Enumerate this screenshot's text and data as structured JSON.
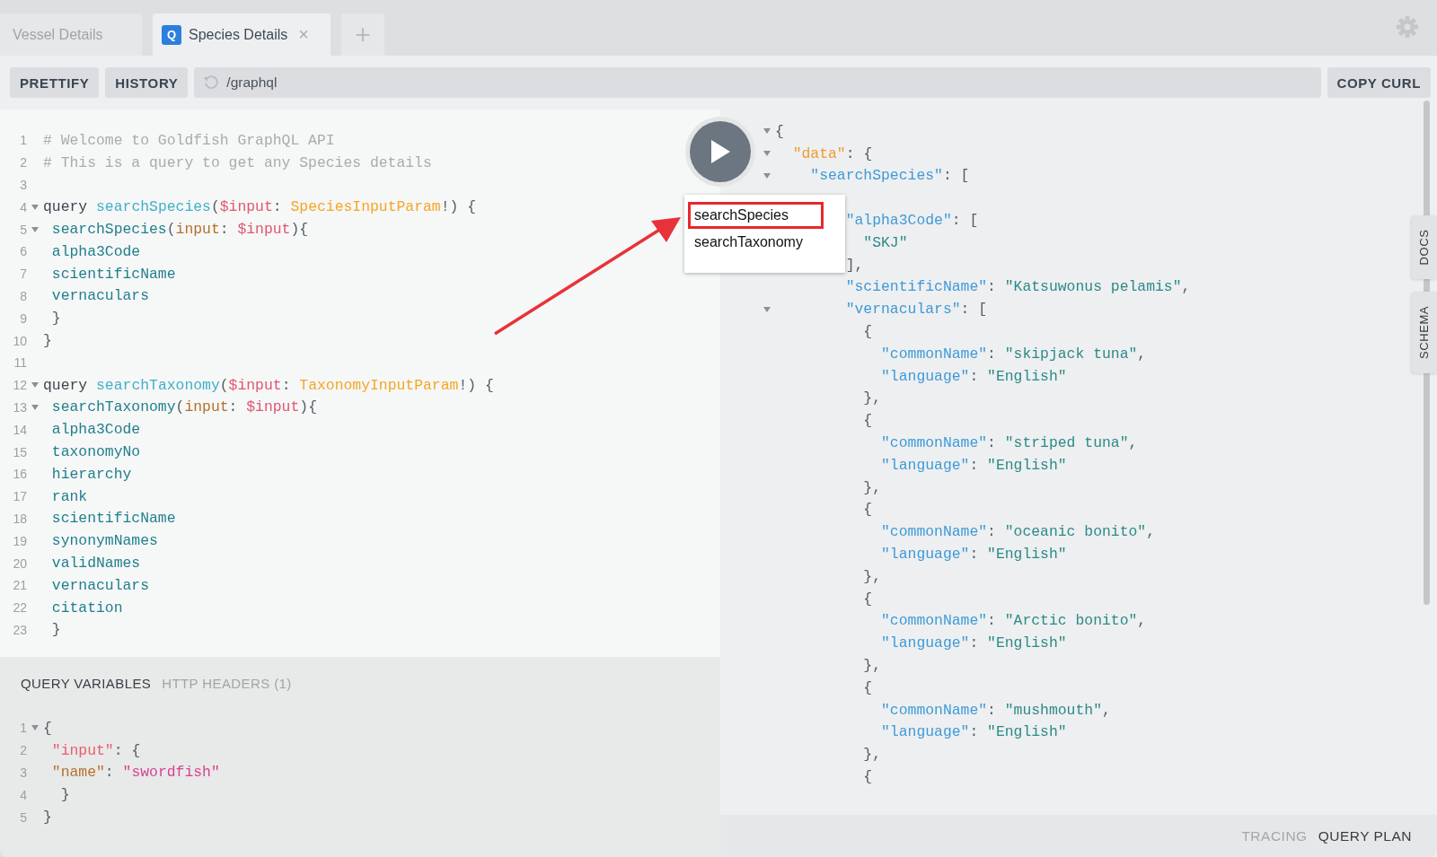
{
  "tabs": [
    {
      "label": "Vessel Details",
      "selected": false
    },
    {
      "label": "Species Details",
      "selected": true,
      "badge": "Q",
      "close": "×"
    }
  ],
  "add_tab": "+",
  "toolbar": {
    "buttons": [
      "PRETTIFY",
      "HISTORY"
    ],
    "url": "/graphql",
    "copy_button": "COPY CURL"
  },
  "editor": {
    "lines": [
      {
        "number": "1",
        "tokens": [
          {
            "kind": "comment",
            "text": "# Welcome to Goldfish GraphQL API"
          }
        ]
      },
      {
        "number": "2",
        "tokens": [
          {
            "kind": "comment",
            "text": "# This is a query to get any Species details"
          }
        ]
      },
      {
        "number": "3"
      },
      {
        "number": "4",
        "fold_marker": true,
        "tokens": [
          {
            "kind": "keyword",
            "text": "query "
          },
          {
            "kind": "def",
            "text": "searchSpecies"
          },
          {
            "kind": "punct",
            "text": "("
          },
          {
            "kind": "variable",
            "text": "$input"
          },
          {
            "kind": "punct",
            "text": ": "
          },
          {
            "kind": "type",
            "text": "SpeciesInputParam"
          },
          {
            "kind": "punct",
            "text": "!) {"
          }
        ]
      },
      {
        "number": "5",
        "fold_marker": true,
        "tokens": [
          {
            "kind": "field",
            "text": " searchSpecies"
          },
          {
            "kind": "punct",
            "text": "("
          },
          {
            "kind": "attribute",
            "text": "input"
          },
          {
            "kind": "punct",
            "text": ": "
          },
          {
            "kind": "variable",
            "text": "$input"
          },
          {
            "kind": "punct",
            "text": "){"
          }
        ]
      },
      {
        "number": "6",
        "tokens": [
          {
            "kind": "field",
            "text": " alpha3Code"
          }
        ]
      },
      {
        "number": "7",
        "tokens": [
          {
            "kind": "field",
            "text": " scientificName"
          }
        ]
      },
      {
        "number": "8",
        "tokens": [
          {
            "kind": "field",
            "text": " vernaculars"
          }
        ]
      },
      {
        "number": "9",
        "tokens": [
          {
            "kind": "punct",
            "text": " }"
          }
        ]
      },
      {
        "number": "10",
        "tokens": [
          {
            "kind": "punct",
            "text": "}"
          }
        ]
      },
      {
        "number": "11"
      },
      {
        "number": "12",
        "fold_marker": true,
        "tokens": [
          {
            "kind": "keyword",
            "text": "query "
          },
          {
            "kind": "def",
            "text": "searchTaxonomy"
          },
          {
            "kind": "punct",
            "text": "("
          },
          {
            "kind": "variable",
            "text": "$input"
          },
          {
            "kind": "punct",
            "text": ": "
          },
          {
            "kind": "type",
            "text": "TaxonomyInputParam"
          },
          {
            "kind": "punct",
            "text": "!) {"
          }
        ]
      },
      {
        "number": "13",
        "fold_marker": true,
        "tokens": [
          {
            "kind": "field",
            "text": " searchTaxonomy"
          },
          {
            "kind": "punct",
            "text": "("
          },
          {
            "kind": "attribute",
            "text": "input"
          },
          {
            "kind": "punct",
            "text": ": "
          },
          {
            "kind": "variable",
            "text": "$input"
          },
          {
            "kind": "punct",
            "text": "){"
          }
        ]
      },
      {
        "number": "14",
        "tokens": [
          {
            "kind": "field",
            "text": " alpha3Code"
          }
        ]
      },
      {
        "number": "15",
        "tokens": [
          {
            "kind": "field",
            "text": " taxonomyNo"
          }
        ]
      },
      {
        "number": "16",
        "tokens": [
          {
            "kind": "field",
            "text": " hierarchy"
          }
        ]
      },
      {
        "number": "17",
        "tokens": [
          {
            "kind": "field",
            "text": " rank"
          }
        ]
      },
      {
        "number": "18",
        "tokens": [
          {
            "kind": "field",
            "text": " scientificName"
          }
        ]
      },
      {
        "number": "19",
        "tokens": [
          {
            "kind": "field",
            "text": " synonymNames"
          }
        ]
      },
      {
        "number": "20",
        "tokens": [
          {
            "kind": "field",
            "text": " validNames"
          }
        ]
      },
      {
        "number": "21",
        "tokens": [
          {
            "kind": "field",
            "text": " vernaculars"
          }
        ]
      },
      {
        "number": "22",
        "tokens": [
          {
            "kind": "field",
            "text": " citation"
          }
        ]
      },
      {
        "number": "23",
        "tokens": [
          {
            "kind": "punct",
            "text": " }"
          }
        ]
      }
    ]
  },
  "variables": {
    "tabs": [
      {
        "label": "QUERY VARIABLES",
        "selected": true
      },
      {
        "label": "HTTP HEADERS (1)",
        "selected": false
      }
    ],
    "lines": [
      {
        "number": "1",
        "fold_marker": true,
        "tokens": [
          {
            "kind": "punct",
            "text": "{"
          }
        ]
      },
      {
        "number": "2",
        "tokens": [
          {
            "kind": "key",
            "text": " \"input\""
          },
          {
            "kind": "punct",
            "text": ": {"
          }
        ]
      },
      {
        "number": "3",
        "tokens": [
          {
            "kind": "attribute",
            "text": " \"name\""
          },
          {
            "kind": "punct",
            "text": ": "
          },
          {
            "kind": "string",
            "text": "\"swordfish\""
          }
        ]
      },
      {
        "number": "4",
        "tokens": [
          {
            "kind": "punct",
            "text": "  }"
          }
        ]
      },
      {
        "number": "5",
        "tokens": [
          {
            "kind": "punct",
            "text": "}"
          }
        ]
      }
    ]
  },
  "run_menu": {
    "operations": [
      {
        "name": "searchSpecies",
        "highlighted": true
      },
      {
        "name": "searchTaxonomy",
        "highlighted": false
      }
    ]
  },
  "annotation": {
    "kind": "arrow"
  },
  "result": {
    "lines": [
      {
        "fold_marker": true,
        "tokens": [
          {
            "kind": "punct",
            "text": "{"
          }
        ]
      },
      {
        "fold_marker": true,
        "tokens": [
          {
            "kind": "accent",
            "text": "  \"data\""
          },
          {
            "kind": "punct",
            "text": ": {"
          }
        ]
      },
      {
        "fold_marker": true,
        "tokens": [
          {
            "kind": "key",
            "text": "    \"searchSpecies\""
          },
          {
            "kind": "punct",
            "text": ": ["
          }
        ]
      },
      {
        "blank_line_before": true,
        "tokens": [
          {
            "kind": "key",
            "text": "        \"alpha3Code\""
          },
          {
            "kind": "punct",
            "text": ": ["
          }
        ]
      },
      {
        "tokens": [
          {
            "kind": "string",
            "text": "          \"SKJ\""
          }
        ]
      },
      {
        "tokens": [
          {
            "kind": "punct",
            "text": "        ],"
          }
        ]
      },
      {
        "tokens": [
          {
            "kind": "key",
            "text": "        \"scientificName\""
          },
          {
            "kind": "punct",
            "text": ": "
          },
          {
            "kind": "string",
            "text": "\"Katsuwonus pelamis\""
          },
          {
            "kind": "punct",
            "text": ","
          }
        ]
      },
      {
        "fold_marker": true,
        "tokens": [
          {
            "kind": "key",
            "text": "        \"vernaculars\""
          },
          {
            "kind": "punct",
            "text": ": ["
          }
        ]
      },
      {
        "tokens": [
          {
            "kind": "punct",
            "text": "          {"
          }
        ]
      },
      {
        "tokens": [
          {
            "kind": "key",
            "text": "            \"commonName\""
          },
          {
            "kind": "punct",
            "text": ": "
          },
          {
            "kind": "string",
            "text": "\"skipjack tuna\""
          },
          {
            "kind": "punct",
            "text": ","
          }
        ]
      },
      {
        "tokens": [
          {
            "kind": "key",
            "text": "            \"language\""
          },
          {
            "kind": "punct",
            "text": ": "
          },
          {
            "kind": "string",
            "text": "\"English\""
          }
        ]
      },
      {
        "tokens": [
          {
            "kind": "punct",
            "text": "          },"
          }
        ]
      },
      {
        "tokens": [
          {
            "kind": "punct",
            "text": "          {"
          }
        ]
      },
      {
        "tokens": [
          {
            "kind": "key",
            "text": "            \"commonName\""
          },
          {
            "kind": "punct",
            "text": ": "
          },
          {
            "kind": "string",
            "text": "\"striped tuna\""
          },
          {
            "kind": "punct",
            "text": ","
          }
        ]
      },
      {
        "tokens": [
          {
            "kind": "key",
            "text": "            \"language\""
          },
          {
            "kind": "punct",
            "text": ": "
          },
          {
            "kind": "string",
            "text": "\"English\""
          }
        ]
      },
      {
        "tokens": [
          {
            "kind": "punct",
            "text": "          },"
          }
        ]
      },
      {
        "tokens": [
          {
            "kind": "punct",
            "text": "          {"
          }
        ]
      },
      {
        "tokens": [
          {
            "kind": "key",
            "text": "            \"commonName\""
          },
          {
            "kind": "punct",
            "text": ": "
          },
          {
            "kind": "string",
            "text": "\"oceanic bonito\""
          },
          {
            "kind": "punct",
            "text": ","
          }
        ]
      },
      {
        "tokens": [
          {
            "kind": "key",
            "text": "            \"language\""
          },
          {
            "kind": "punct",
            "text": ": "
          },
          {
            "kind": "string",
            "text": "\"English\""
          }
        ]
      },
      {
        "tokens": [
          {
            "kind": "punct",
            "text": "          },"
          }
        ]
      },
      {
        "tokens": [
          {
            "kind": "punct",
            "text": "          {"
          }
        ]
      },
      {
        "tokens": [
          {
            "kind": "key",
            "text": "            \"commonName\""
          },
          {
            "kind": "punct",
            "text": ": "
          },
          {
            "kind": "string",
            "text": "\"Arctic bonito\""
          },
          {
            "kind": "punct",
            "text": ","
          }
        ]
      },
      {
        "tokens": [
          {
            "kind": "key",
            "text": "            \"language\""
          },
          {
            "kind": "punct",
            "text": ": "
          },
          {
            "kind": "string",
            "text": "\"English\""
          }
        ]
      },
      {
        "tokens": [
          {
            "kind": "punct",
            "text": "          },"
          }
        ]
      },
      {
        "tokens": [
          {
            "kind": "punct",
            "text": "          {"
          }
        ]
      },
      {
        "tokens": [
          {
            "kind": "key",
            "text": "            \"commonName\""
          },
          {
            "kind": "punct",
            "text": ": "
          },
          {
            "kind": "string",
            "text": "\"mushmouth\""
          },
          {
            "kind": "punct",
            "text": ","
          }
        ]
      },
      {
        "tokens": [
          {
            "kind": "key",
            "text": "            \"language\""
          },
          {
            "kind": "punct",
            "text": ": "
          },
          {
            "kind": "string",
            "text": "\"English\""
          }
        ]
      },
      {
        "tokens": [
          {
            "kind": "punct",
            "text": "          },"
          }
        ]
      },
      {
        "tokens": [
          {
            "kind": "punct",
            "text": "          {"
          }
        ]
      }
    ]
  },
  "side_tabs": [
    "DOCS",
    "SCHEMA"
  ],
  "footer_tabs": [
    {
      "label": "TRACING",
      "selected": false
    },
    {
      "label": "QUERY PLAN",
      "selected": true
    }
  ]
}
